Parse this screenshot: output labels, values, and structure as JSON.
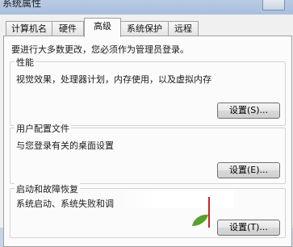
{
  "window": {
    "title": "系统属性"
  },
  "tabs": [
    {
      "label": "计算机名",
      "active": false
    },
    {
      "label": "硬件",
      "active": false
    },
    {
      "label": "高级",
      "active": true
    },
    {
      "label": "系统保护",
      "active": false
    },
    {
      "label": "远程",
      "active": false
    }
  ],
  "notice": "要进行大多数更改，您必须作为管理员登录。",
  "performance": {
    "title": "性能",
    "description": "视觉效果，处理器计划，内存使用，以及虚拟内存",
    "button": "设置(S)..."
  },
  "user_profiles": {
    "title": "用户配置文件",
    "description": "与您登录有关的桌面设置",
    "button": "设置(E)..."
  },
  "startup_recovery": {
    "title": "启动和故障恢复",
    "description": "系统启动、系统失败和调",
    "button": "设置(T)..."
  },
  "colors": {
    "highlight_red": "#d02020",
    "leaf_green": "#5aa02c"
  }
}
